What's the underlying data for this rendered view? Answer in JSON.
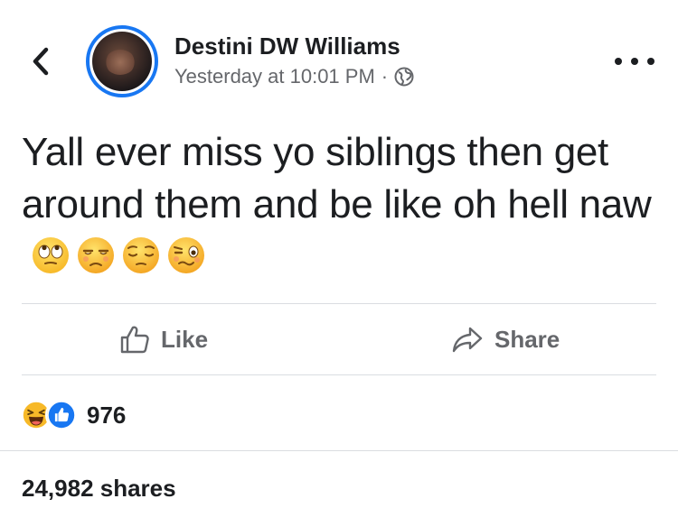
{
  "header": {
    "back_icon": "chevron-left-icon",
    "author_name": "Destini DW Williams",
    "timestamp": "Yesterday at 10:01 PM",
    "separator": "·",
    "privacy_icon": "globe-icon",
    "more_icon": "ellipsis-icon",
    "accent_color": "#1877f2"
  },
  "post": {
    "text": "Yall ever miss yo siblings then get around them and be like oh hell naw",
    "emojis": [
      "eye-roll-emoji",
      "unamused-emoji",
      "pensive-emoji",
      "woozy-emoji"
    ]
  },
  "actions": {
    "like_label": "Like",
    "share_label": "Share"
  },
  "reactions": {
    "icons": [
      "haha-reaction-icon",
      "like-reaction-icon"
    ],
    "count": "976"
  },
  "shares": {
    "label": "24,982 shares"
  }
}
